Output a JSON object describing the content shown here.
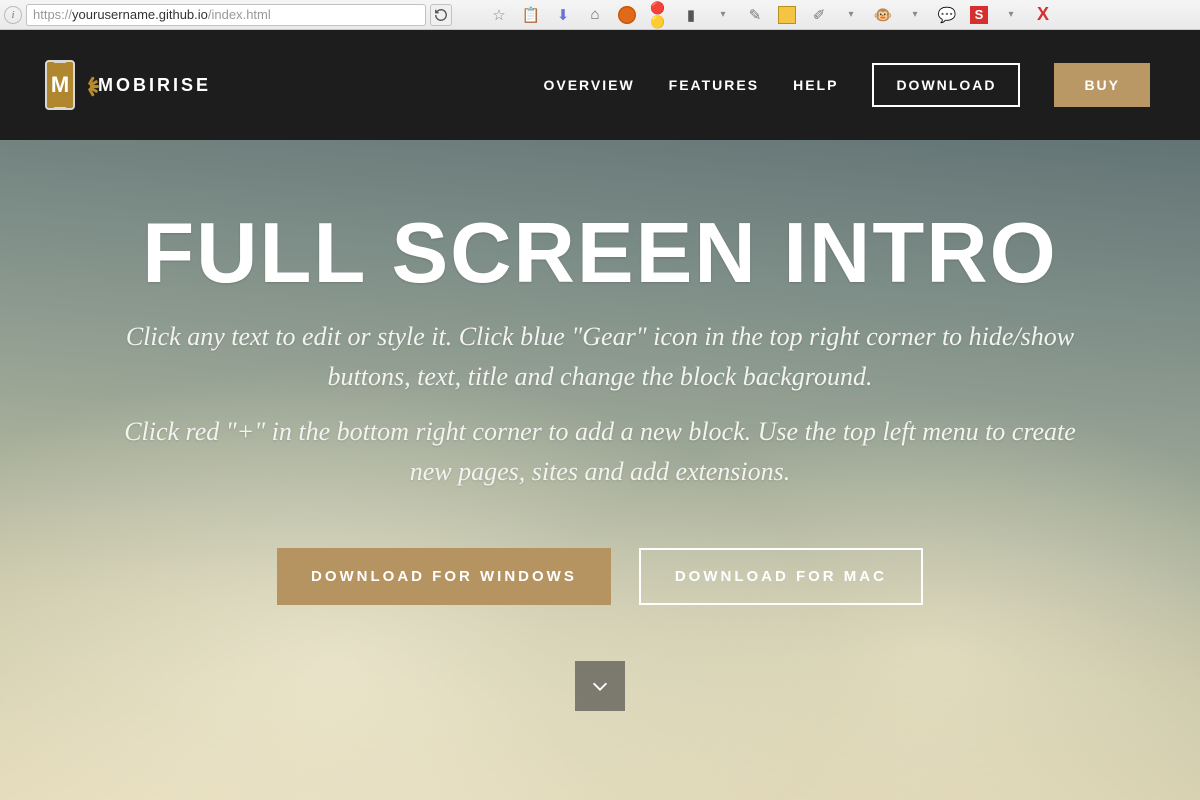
{
  "browser": {
    "url_host": "yourusername.github.io",
    "url_prefix": "https://",
    "url_path": "/index.html"
  },
  "header": {
    "brand": "MOBIRISE",
    "logo_letter": "M",
    "nav": {
      "overview": "OVERVIEW",
      "features": "FEATURES",
      "help": "HELP"
    },
    "download": "DOWNLOAD",
    "buy": "BUY"
  },
  "hero": {
    "title": "FULL SCREEN INTRO",
    "subtitle1": "Click any text to edit or style it. Click blue \"Gear\" icon in the top right corner to hide/show buttons, text, title and change the block background.",
    "subtitle2": "Click red \"+\" in the bottom right corner to add a new block. Use the top left menu to create new pages, sites and add extensions.",
    "btn_windows": "DOWNLOAD FOR WINDOWS",
    "btn_mac": "DOWNLOAD FOR MAC"
  },
  "colors": {
    "accent": "#b59461",
    "header_bg": "#1d1d1d"
  }
}
